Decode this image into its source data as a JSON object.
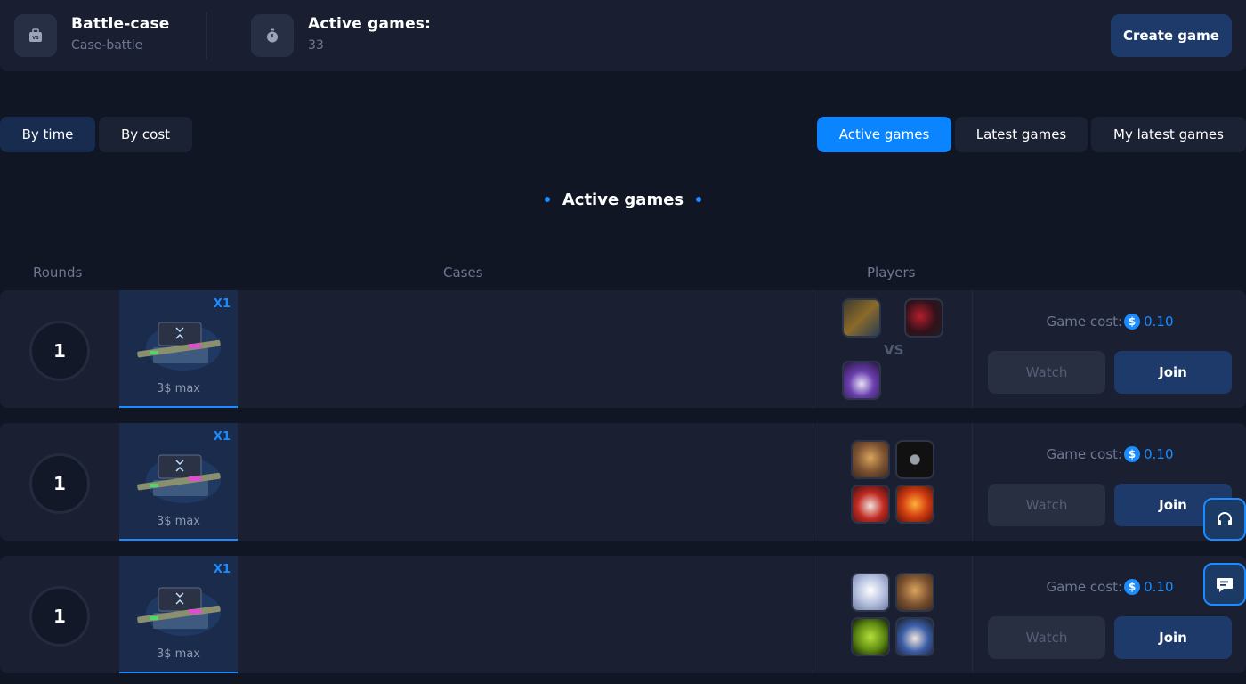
{
  "header": {
    "mode_title": "Battle-case",
    "mode_subtitle": "Case-battle",
    "active_label": "Active games:",
    "active_count": "33",
    "create_button": "Create game"
  },
  "sort_tabs": [
    "By time",
    "By cost"
  ],
  "view_tabs": [
    "Active games",
    "Latest games",
    "My latest games"
  ],
  "section_title": "Active games",
  "columns": {
    "rounds": "Rounds",
    "cases": "Cases",
    "players": "Players"
  },
  "games": [
    {
      "rounds": "1",
      "case": {
        "multiplier": "X1",
        "price": "3$ max"
      },
      "vs_label": "VS",
      "cost_label": "Game cost:",
      "coin_symbol": "$",
      "cost": "0.10",
      "watch": "Watch",
      "join": "Join"
    },
    {
      "rounds": "1",
      "case": {
        "multiplier": "X1",
        "price": "3$ max"
      },
      "cost_label": "Game cost:",
      "coin_symbol": "$",
      "cost": "0.10",
      "watch": "Watch",
      "join": "Join"
    },
    {
      "rounds": "1",
      "case": {
        "multiplier": "X1",
        "price": "3$ max"
      },
      "cost_label": "Game cost:",
      "coin_symbol": "$",
      "cost": "0.10",
      "watch": "Watch",
      "join": "Join"
    }
  ],
  "floating": {
    "support_icon": "headset-icon",
    "chat_icon": "chat-icon"
  },
  "colors": {
    "accent": "#1a8cff",
    "page_bg": "#111624",
    "row_bg": "#1a2032",
    "join_bg": "#1d3a6a"
  }
}
